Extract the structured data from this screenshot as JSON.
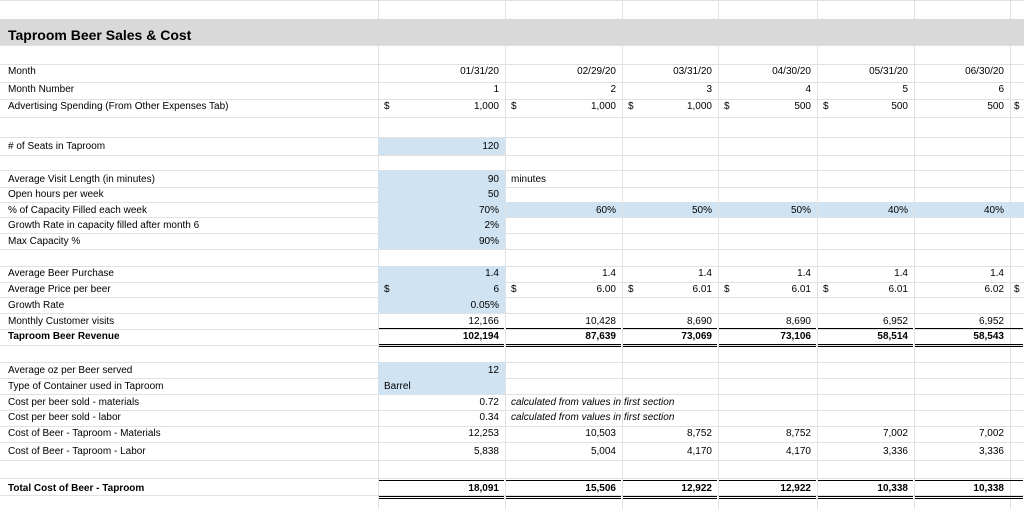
{
  "sheet": {
    "title": "Taproom Beer Sales & Cost",
    "currency_symbol": "$",
    "months": [
      "01/31/20",
      "02/29/20",
      "03/31/20",
      "04/30/20",
      "05/31/20",
      "06/30/20"
    ],
    "month_numbers": [
      "1",
      "2",
      "3",
      "4",
      "5",
      "6"
    ],
    "rows": {
      "month": "Month",
      "month_number": "Month Number",
      "advertising": "Advertising Spending (From Other Expenses Tab)",
      "seats": "# of Seats in Taproom",
      "visit_length": "Average Visit Length (in minutes)",
      "open_hours": "Open hours per week",
      "capacity_filled": "% of Capacity Filled each week",
      "growth_capacity": "Growth Rate in capacity filled after month 6",
      "max_capacity": "Max Capacity %",
      "avg_beer_purchase": "Average Beer Purchase",
      "avg_price": "Average Price per beer",
      "growth_rate": "Growth Rate",
      "customer_visits": "Monthly Customer visits",
      "revenue": "Taproom Beer Revenue",
      "avg_oz": "Average oz per Beer served",
      "container": "Type of Container used in Taproom",
      "cost_materials": "Cost per beer sold - materials",
      "cost_labor": "Cost per beer sold - labor",
      "cost_beer_materials": "Cost of Beer - Taproom - Materials",
      "cost_beer_labor": "Cost of Beer - Taproom - Labor",
      "total_cost": "Total Cost of Beer - Taproom"
    },
    "values": {
      "advertising": [
        "1,000",
        "1,000",
        "1,000",
        "500",
        "500",
        "500"
      ],
      "seats": "120",
      "visit_length": "90",
      "visit_length_unit": "minutes",
      "open_hours": "50",
      "capacity_filled": [
        "70%",
        "60%",
        "50%",
        "50%",
        "40%",
        "40%"
      ],
      "growth_capacity": "2%",
      "max_capacity": "90%",
      "avg_beer_purchase": [
        "1.4",
        "1.4",
        "1.4",
        "1.4",
        "1.4",
        "1.4"
      ],
      "avg_price": [
        "6",
        "6.00",
        "6.01",
        "6.01",
        "6.01",
        "6.02"
      ],
      "growth_rate": "0.05%",
      "customer_visits": [
        "12,166",
        "10,428",
        "8,690",
        "8,690",
        "6,952",
        "6,952"
      ],
      "revenue": [
        "102,194",
        "87,639",
        "73,069",
        "73,106",
        "58,514",
        "58,543"
      ],
      "avg_oz": "12",
      "container": "Barrel",
      "cost_materials": "0.72",
      "cost_labor": "0.34",
      "cost_note": "calculated from values in first section",
      "cost_beer_materials": [
        "12,253",
        "10,503",
        "8,752",
        "8,752",
        "7,002",
        "7,002"
      ],
      "cost_beer_labor": [
        "5,838",
        "5,004",
        "4,170",
        "4,170",
        "3,336",
        "3,336"
      ],
      "total_cost": [
        "18,091",
        "15,506",
        "12,922",
        "12,922",
        "10,338",
        "10,338"
      ]
    },
    "colors": {
      "title_band": "#d9d9d9",
      "input_fill": "#cfe3f3",
      "grid": "#e1e1e1"
    }
  }
}
